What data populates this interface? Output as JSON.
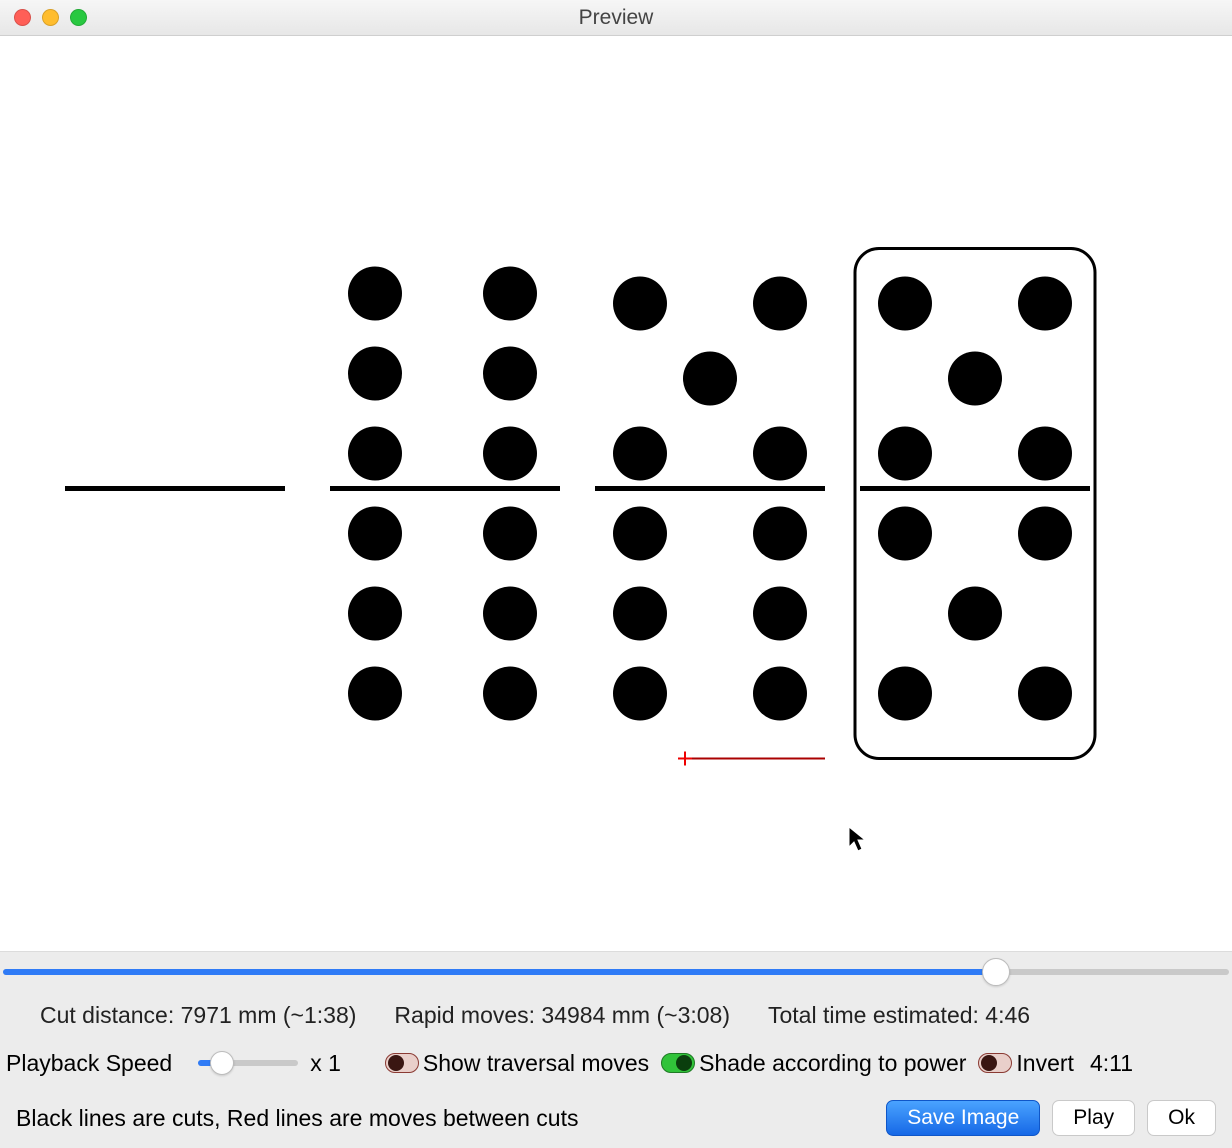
{
  "window": {
    "title": "Preview"
  },
  "stats": {
    "cut_distance": "Cut distance: 7971 mm (~1:38)",
    "rapid_moves": "Rapid moves: 34984 mm (~3:08)",
    "total_time": "Total time estimated: 4:46"
  },
  "playback": {
    "label": "Playback Speed",
    "value_text": "x 1",
    "slider_percent": 24
  },
  "timeline": {
    "percent": 81
  },
  "toggles": {
    "traversal": {
      "label": "Show traversal moves",
      "on": false
    },
    "shade": {
      "label": "Shade according to power",
      "on": true
    },
    "invert": {
      "label": "Invert",
      "on": false
    }
  },
  "time_display": "4:11",
  "legend": "Black lines are cuts, Red lines are moves between cuts",
  "buttons": {
    "save_image": "Save Image",
    "play": "Play",
    "ok": "Ok"
  }
}
